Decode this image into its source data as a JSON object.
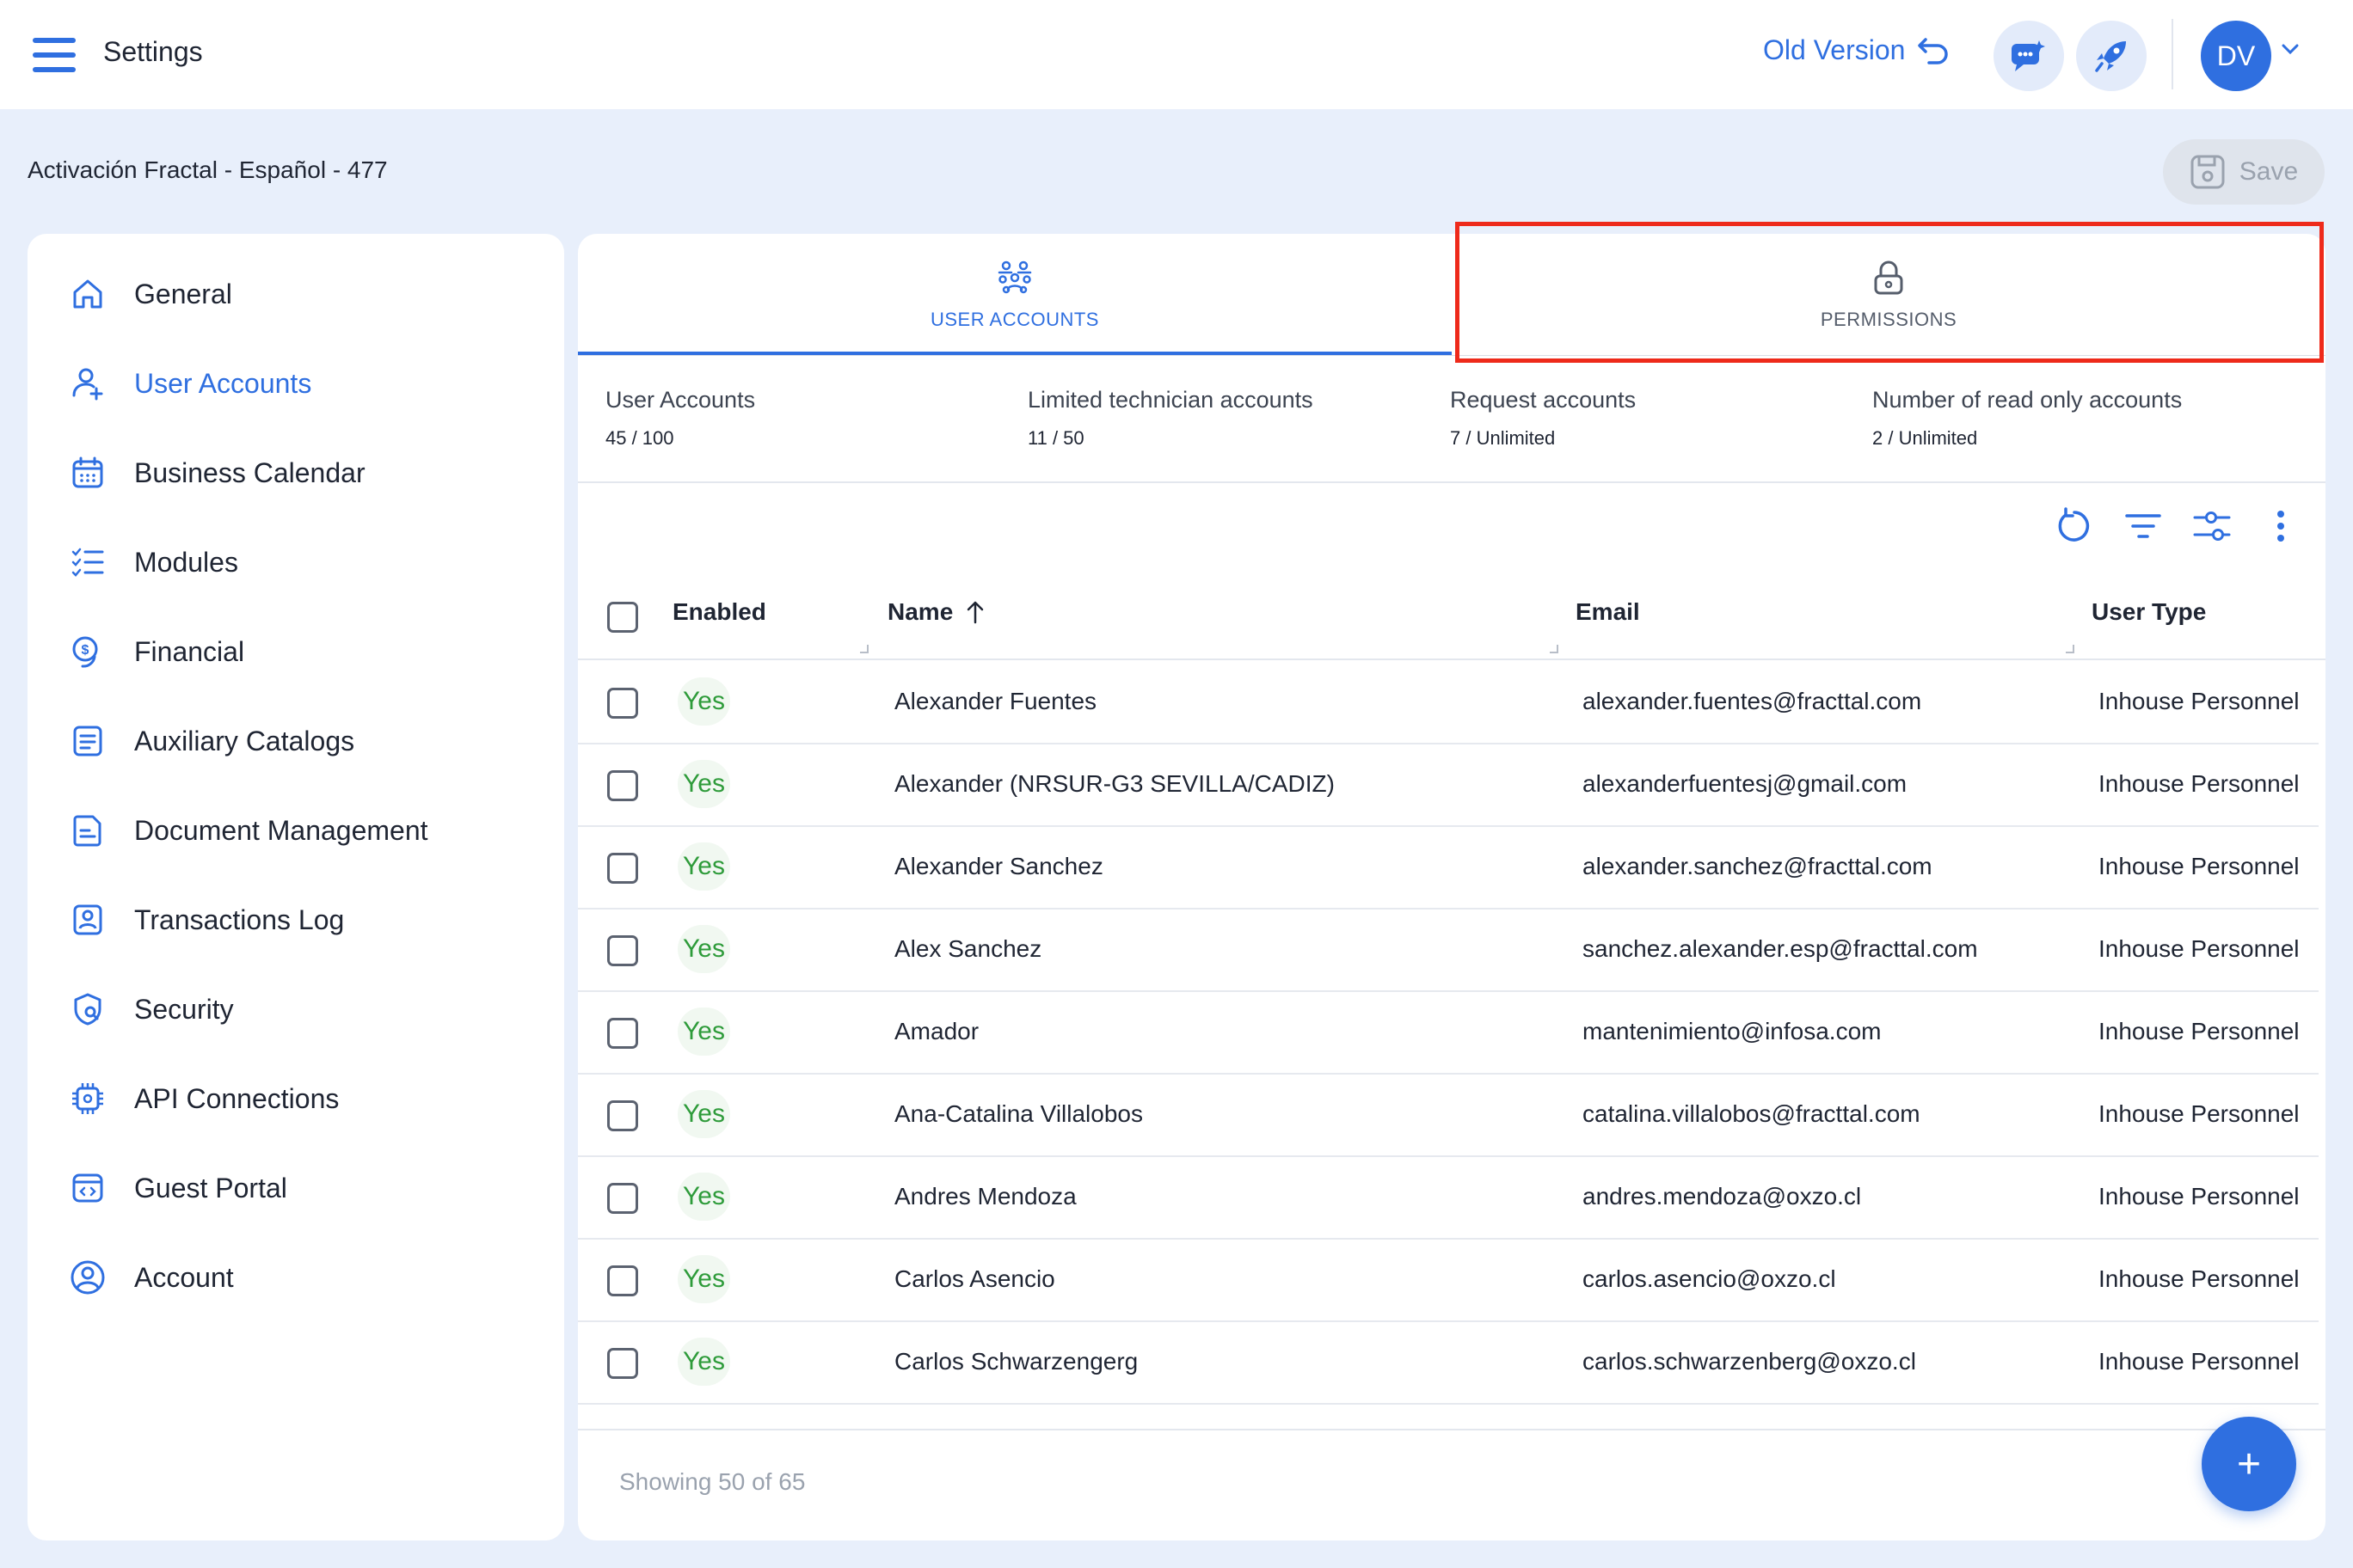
{
  "header": {
    "title": "Settings",
    "old_version_label": "Old Version",
    "avatar_initials": "DV"
  },
  "page": {
    "breadcrumb": "Activación Fractal - Español - 477",
    "save_label": "Save"
  },
  "sidebar": {
    "items": [
      {
        "label": "General",
        "icon": "home-icon"
      },
      {
        "label": "User Accounts",
        "icon": "user-add-icon",
        "active": true
      },
      {
        "label": "Business Calendar",
        "icon": "calendar-icon"
      },
      {
        "label": "Modules",
        "icon": "checklist-icon"
      },
      {
        "label": "Financial",
        "icon": "money-icon"
      },
      {
        "label": "Auxiliary Catalogs",
        "icon": "catalog-icon"
      },
      {
        "label": "Document Management",
        "icon": "document-icon"
      },
      {
        "label": "Transactions Log",
        "icon": "log-icon"
      },
      {
        "label": "Security",
        "icon": "security-icon"
      },
      {
        "label": "API Connections",
        "icon": "api-icon"
      },
      {
        "label": "Guest Portal",
        "icon": "portal-icon"
      },
      {
        "label": "Account",
        "icon": "account-icon"
      }
    ]
  },
  "tabs": {
    "user_accounts": "USER ACCOUNTS",
    "permissions": "PERMISSIONS"
  },
  "stats": [
    {
      "label": "User Accounts",
      "value": "45 / 100"
    },
    {
      "label": "Limited technician accounts",
      "value": "11 / 50"
    },
    {
      "label": "Request accounts",
      "value": "7 / Unlimited"
    },
    {
      "label": "Number of read only accounts",
      "value": "2 / Unlimited"
    }
  ],
  "table": {
    "columns": {
      "enabled": "Enabled",
      "name": "Name",
      "email": "Email",
      "user_type": "User Type"
    },
    "rows": [
      {
        "enabled": "Yes",
        "name": "Alexander Fuentes",
        "email": "alexander.fuentes@fracttal.com",
        "user_type": "Inhouse Personnel"
      },
      {
        "enabled": "Yes",
        "name": "Alexander (NRSUR-G3 SEVILLA/CADIZ)",
        "email": "alexanderfuentesj@gmail.com",
        "user_type": "Inhouse Personnel"
      },
      {
        "enabled": "Yes",
        "name": "Alexander Sanchez",
        "email": "alexander.sanchez@fracttal.com",
        "user_type": "Inhouse Personnel"
      },
      {
        "enabled": "Yes",
        "name": "Alex Sanchez",
        "email": "sanchez.alexander.esp@fracttal.com",
        "user_type": "Inhouse Personnel"
      },
      {
        "enabled": "Yes",
        "name": "Amador",
        "email": "mantenimiento@infosa.com",
        "user_type": "Inhouse Personnel"
      },
      {
        "enabled": "Yes",
        "name": "Ana-Catalina Villalobos",
        "email": "catalina.villalobos@fracttal.com",
        "user_type": "Inhouse Personnel"
      },
      {
        "enabled": "Yes",
        "name": "Andres Mendoza",
        "email": "andres.mendoza@oxzo.cl",
        "user_type": "Inhouse Personnel"
      },
      {
        "enabled": "Yes",
        "name": "Carlos Asencio",
        "email": "carlos.asencio@oxzo.cl",
        "user_type": "Inhouse Personnel"
      },
      {
        "enabled": "Yes",
        "name": "Carlos Schwarzengerg",
        "email": "carlos.schwarzenberg@oxzo.cl",
        "user_type": "Inhouse Personnel"
      }
    ]
  },
  "footer": {
    "showing": "Showing 50 of 65",
    "fab_symbol": "+"
  },
  "colors": {
    "accent": "#2f6fe0",
    "background": "#e8effb",
    "enabled_text": "#2e9b3a",
    "highlight": "#ee2a1b"
  }
}
